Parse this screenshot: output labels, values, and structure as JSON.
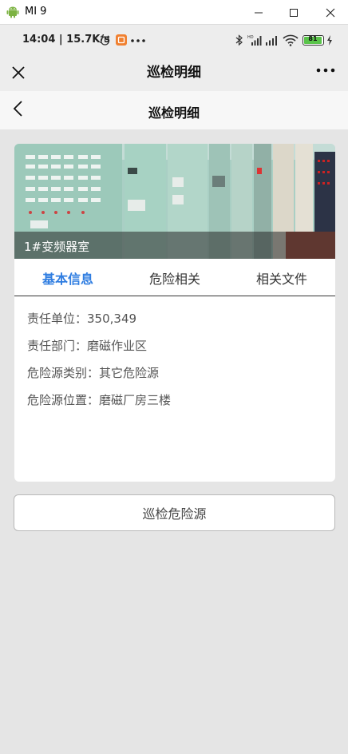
{
  "window": {
    "title": "MI 9"
  },
  "status_bar": {
    "time_speed": "14:04 | 15.7K/s",
    "battery": "81"
  },
  "wechat_nav": {
    "title": "巡检明细"
  },
  "page_header": {
    "title": "巡检明细"
  },
  "card": {
    "caption": "1#变频器室",
    "tabs": [
      {
        "label": "基本信息",
        "active": true
      },
      {
        "label": "危险相关",
        "active": false
      },
      {
        "label": "相关文件",
        "active": false
      }
    ],
    "info": {
      "unit": "责任单位：350,349",
      "department": "责任部门：磨磁作业区",
      "category": "危险源类别：其它危险源",
      "location": "危险源位置：磨磁厂房三楼"
    }
  },
  "action": {
    "label": "巡检危险源"
  },
  "colors": {
    "accent": "#2f7de1",
    "background": "#e5e5e5"
  }
}
